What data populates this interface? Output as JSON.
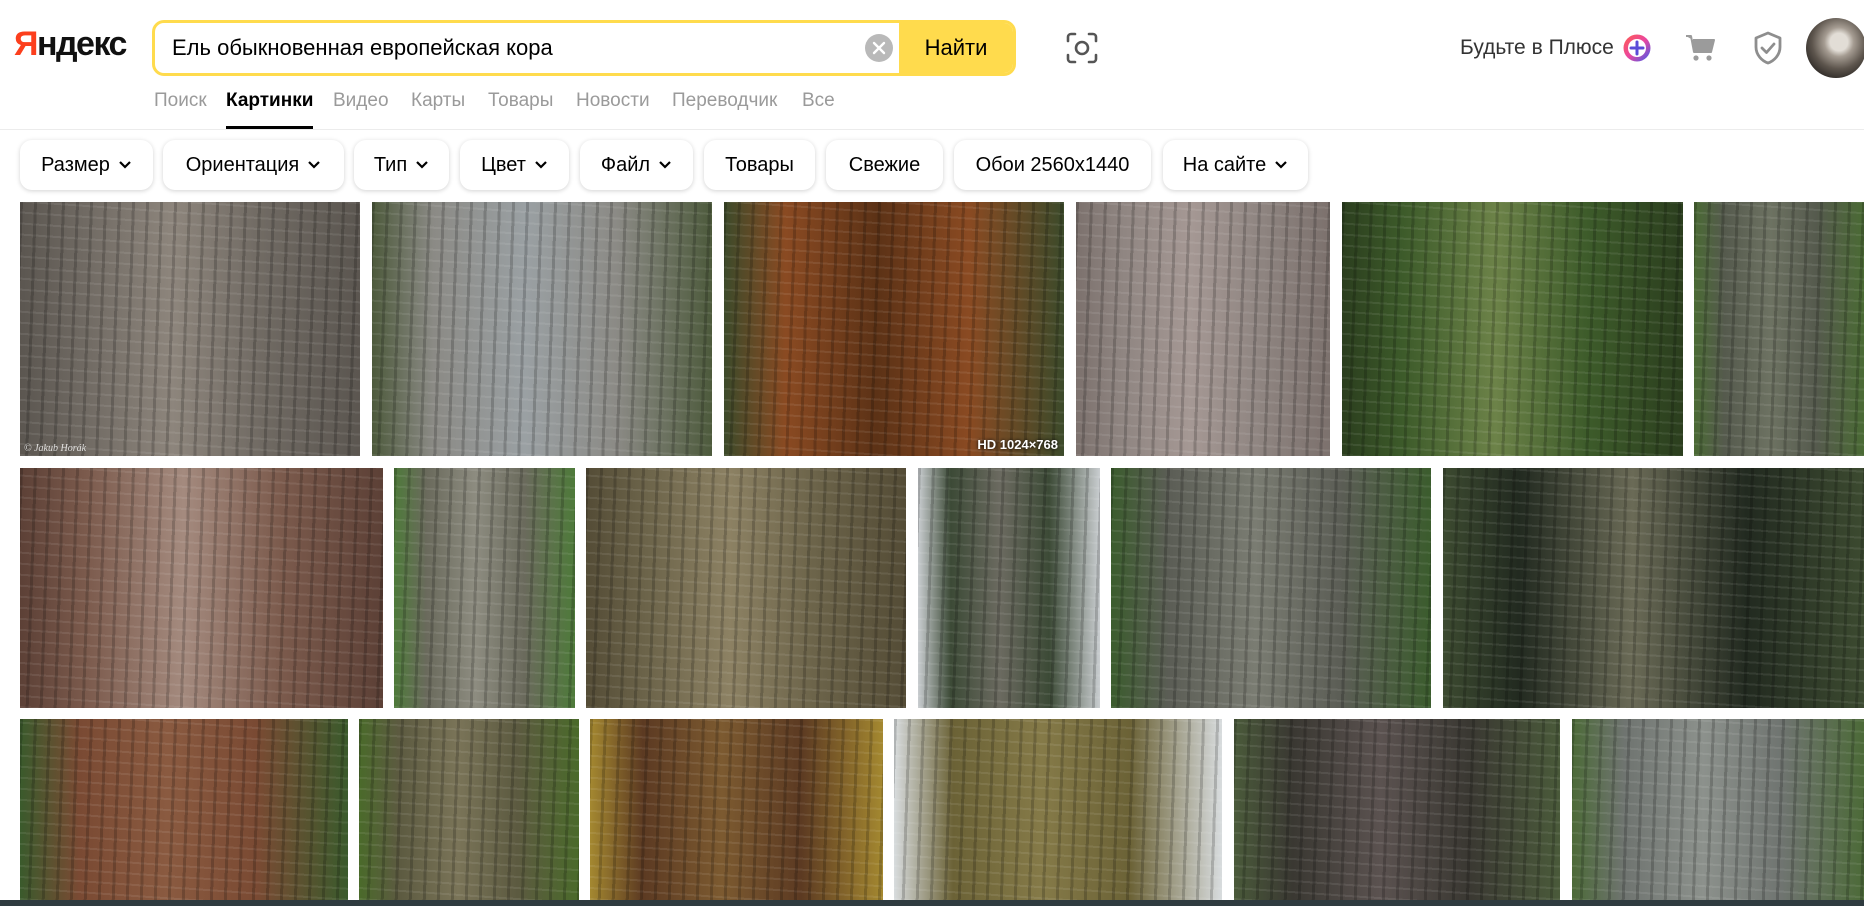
{
  "logo": {
    "first": "Я",
    "rest": "ндекс"
  },
  "search": {
    "query": "Ель обыкновенная европейская кора",
    "find_label": "Найти"
  },
  "header": {
    "plus_text": "Будьте в Плюсе"
  },
  "tabs": [
    {
      "label": "Поиск",
      "active": false
    },
    {
      "label": "Картинки",
      "active": true
    },
    {
      "label": "Видео",
      "active": false
    },
    {
      "label": "Карты",
      "active": false
    },
    {
      "label": "Товары",
      "active": false
    },
    {
      "label": "Новости",
      "active": false
    },
    {
      "label": "Переводчик",
      "active": false
    },
    {
      "label": "Все",
      "active": false
    }
  ],
  "filters": [
    {
      "label": "Размер",
      "dropdown": true
    },
    {
      "label": "Ориентация",
      "dropdown": true
    },
    {
      "label": "Тип",
      "dropdown": true
    },
    {
      "label": "Цвет",
      "dropdown": true
    },
    {
      "label": "Файл",
      "dropdown": true
    },
    {
      "label": "Товары",
      "dropdown": false
    },
    {
      "label": "Свежие",
      "dropdown": false
    },
    {
      "label": "Обои 2560x1440",
      "dropdown": false
    },
    {
      "label": "На сайте",
      "dropdown": true
    }
  ],
  "images": [
    {
      "colors": [
        "#6f6962",
        "#8d857c",
        "#5b5650"
      ],
      "watermark": "© Jakub Horák"
    },
    {
      "colors": [
        "#8b8a85",
        "#9aa0a3",
        "#4d5a3c"
      ]
    },
    {
      "colors": [
        "#8a4a22",
        "#5c3216",
        "#3c4a2a"
      ],
      "badge": "HD 1024×768"
    },
    {
      "colors": [
        "#8f8581",
        "#a59894",
        "#7c716d"
      ]
    },
    {
      "colors": [
        "#3d5b2a",
        "#6c8248",
        "#2b3e1e"
      ]
    },
    {
      "colors": [
        "#555a4d",
        "#6d7262",
        "#4a6a34"
      ]
    },
    {
      "colors": [
        "#7b5a4c",
        "#a48a7e",
        "#5c4036"
      ]
    },
    {
      "colors": [
        "#6a6a5c",
        "#8d8c80",
        "#4e7a3a"
      ]
    },
    {
      "colors": [
        "#6b6349",
        "#8c8163",
        "#544c36"
      ]
    },
    {
      "colors": [
        "#3c4a36",
        "#6b6a60",
        "#c9cdd0"
      ]
    },
    {
      "colors": [
        "#5b5d55",
        "#7a7c72",
        "#3b5c2d"
      ]
    },
    {
      "colors": [
        "#222a20",
        "#6a6a56",
        "#3c4a30"
      ]
    },
    {
      "colors": [
        "#7a4a33",
        "#8a5a40",
        "#3a5a2c"
      ]
    },
    {
      "colors": [
        "#5c5a40",
        "#7a7458",
        "#4a6a2a"
      ]
    },
    {
      "colors": [
        "#5c3a22",
        "#7c5a30",
        "#a48830"
      ]
    },
    {
      "colors": [
        "#6b6236",
        "#857a48",
        "#d8dcde"
      ]
    },
    {
      "colors": [
        "#3a3832",
        "#5b5250",
        "#4a5a3a"
      ]
    },
    {
      "colors": [
        "#6f7470",
        "#8c918c",
        "#4c6a38"
      ]
    }
  ]
}
